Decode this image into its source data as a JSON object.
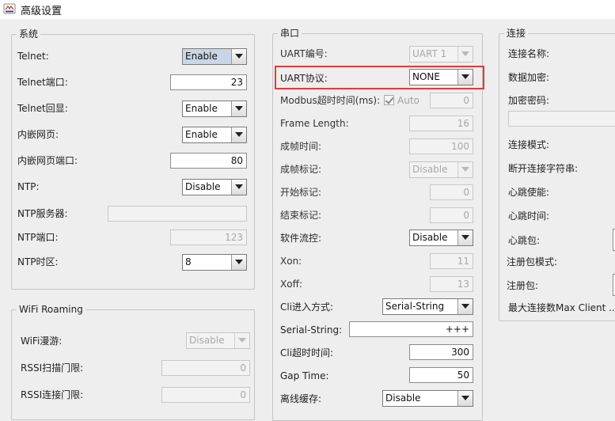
{
  "window": {
    "title": "高级设置"
  },
  "system": {
    "title": "系统",
    "telnet": {
      "label": "Telnet:",
      "value": "Enable"
    },
    "telnet_port": {
      "label": "Telnet端口:",
      "value": "23"
    },
    "telnet_echo": {
      "label": "Telnet回显:",
      "value": "Enable"
    },
    "web": {
      "label": "内嵌网页:",
      "value": "Enable"
    },
    "web_port": {
      "label": "内嵌网页端口:",
      "value": "80"
    },
    "ntp": {
      "label": "NTP:",
      "value": "Disable"
    },
    "ntp_server": {
      "label": "NTP服务器:",
      "value": ""
    },
    "ntp_port": {
      "label": "NTP端口:",
      "value": "123"
    },
    "ntp_tz": {
      "label": "NTP时区:",
      "value": "8"
    }
  },
  "wifi": {
    "title": "WiFi Roaming",
    "roaming": {
      "label": "WiFi漫游:",
      "value": "Disable"
    },
    "rssi_scan": {
      "label": "RSSI扫描门限:",
      "value": "0"
    },
    "rssi_conn": {
      "label": "RSSI连接门限:",
      "value": "0"
    }
  },
  "serial": {
    "title": "串口",
    "uart_no": {
      "label": "UART编号:",
      "value": "UART 1"
    },
    "uart_proto": {
      "label": "UART协议:",
      "value": "NONE"
    },
    "modbus_timeout": {
      "label": "Modbus超时时间(ms):",
      "auto_label": "Auto",
      "value": "0"
    },
    "frame_length": {
      "label": "Frame Length:",
      "value": "16"
    },
    "frame_time": {
      "label": "成帧时间:",
      "value": "100"
    },
    "frame_mark": {
      "label": "成帧标记:",
      "value": "Disable"
    },
    "start_mark": {
      "label": "开始标记:",
      "value": "0"
    },
    "end_mark": {
      "label": "结束标记:",
      "value": "0"
    },
    "flow_ctrl": {
      "label": "软件流控:",
      "value": "Disable"
    },
    "xon": {
      "label": "Xon:",
      "value": "11"
    },
    "xoff": {
      "label": "Xoff:",
      "value": "13"
    },
    "cli_mode": {
      "label": "Cli进入方式:",
      "value": "Serial-String"
    },
    "serial_string": {
      "label": "Serial-String:",
      "value": "+++"
    },
    "cli_timeout": {
      "label": "Cli超时时间:",
      "value": "300"
    },
    "gap_time": {
      "label": "Gap Time:",
      "value": "50"
    },
    "offline_buffer": {
      "label": "离线缓存:",
      "value": "Disable"
    }
  },
  "connection": {
    "title": "连接",
    "name": {
      "label": "连接名称:"
    },
    "encrypt": {
      "label": "数据加密:"
    },
    "password": {
      "label": "加密密码:"
    },
    "mode": {
      "label": "连接模式:"
    },
    "disconnect_str": {
      "label": "断开连接字符串:"
    },
    "heartbeat_enable": {
      "label": "心跳使能:"
    },
    "heartbeat_time": {
      "label": "心跳时间:"
    },
    "heartbeat_pkt": {
      "label": "心跳包:"
    },
    "register_mode": {
      "label": "注册包模式:"
    },
    "register_pkt": {
      "label": "注册包:"
    },
    "max_conn": {
      "label": "最大连接数Max Client ..."
    }
  }
}
